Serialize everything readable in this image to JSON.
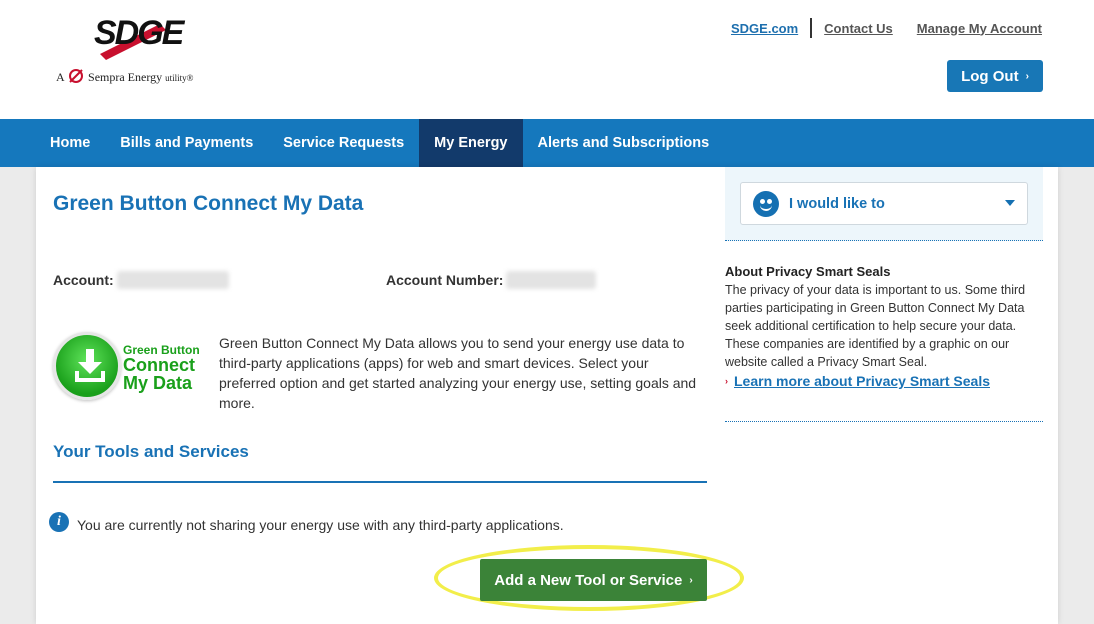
{
  "header": {
    "logo": {
      "brand": "SDGE",
      "tag_prefix": "A",
      "tag_company": "Sempra Energy",
      "tag_suffix": "utility®"
    },
    "links": {
      "site": "SDGE.com",
      "contact": "Contact Us",
      "manage": "Manage My Account"
    },
    "logout": "Log Out"
  },
  "nav": {
    "items": [
      "Home",
      "Bills and Payments",
      "Service Requests",
      "My Energy",
      "Alerts and Subscriptions"
    ],
    "active": "My Energy"
  },
  "main": {
    "title": "Green Button Connect My Data",
    "account_label": "Account:",
    "account_number_label": "Account Number:",
    "gb_logo": {
      "line1": "Green Button",
      "line2": "Connect",
      "line3": "My Data"
    },
    "intro": "Green Button Connect My Data allows you to send your energy use data to third-party applications (apps) for web and smart devices. Select your preferred option and get started analyzing your energy use, setting goals and more.",
    "section_title": "Your Tools and Services",
    "info_message": "You are currently not sharing your energy use with any third-party applications.",
    "add_button": "Add a New Tool or Service"
  },
  "sidebar": {
    "dropdown_label": "I would like to",
    "privacy_title": "About Privacy Smart Seals",
    "privacy_body": "The privacy of your data is important to us.  Some third parties participating in Green Button Connect My Data seek additional certification to help secure your data.  These companies are identified by a graphic on our website called a Privacy Smart Seal.",
    "privacy_link": "Learn more about Privacy Smart Seals"
  },
  "colors": {
    "brand_blue": "#1578bd",
    "nav_active": "#123a6b",
    "green_button": "#3b8338",
    "highlight": "#f2ee4a"
  }
}
